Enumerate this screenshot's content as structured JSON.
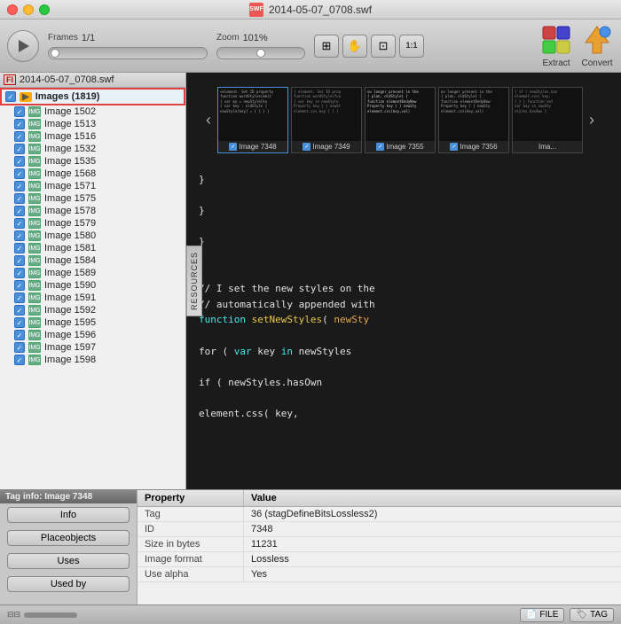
{
  "window": {
    "title": "2014-05-07_0708.swf",
    "traffic_lights": [
      "close",
      "minimize",
      "maximize"
    ]
  },
  "toolbar": {
    "play_label": "Play",
    "frames_label": "Frames",
    "frames_current": "1/1",
    "zoom_label": "Zoom",
    "zoom_value": "101%",
    "extract_label": "Extract",
    "convert_label": "Convert",
    "ratio_label": "1:1"
  },
  "sidebar": {
    "file_label": "2014-05-07_0708.swf",
    "root_label": "Images (1819)",
    "items": [
      {
        "id": "1502",
        "label": "Image 1502",
        "checked": true
      },
      {
        "id": "1513",
        "label": "Image 1513",
        "checked": true
      },
      {
        "id": "1516",
        "label": "Image 1516",
        "checked": true
      },
      {
        "id": "1532",
        "label": "Image 1532",
        "checked": true
      },
      {
        "id": "1535",
        "label": "Image 1535",
        "checked": true
      },
      {
        "id": "1568",
        "label": "Image 1568",
        "checked": true
      },
      {
        "id": "1571",
        "label": "Image 1571",
        "checked": true
      },
      {
        "id": "1575",
        "label": "Image 1575",
        "checked": true
      },
      {
        "id": "1578",
        "label": "Image 1578",
        "checked": true
      },
      {
        "id": "1579",
        "label": "Image 1579",
        "checked": true
      },
      {
        "id": "1580",
        "label": "Image 1580",
        "checked": true
      },
      {
        "id": "1581",
        "label": "Image 1581",
        "checked": true
      },
      {
        "id": "1584",
        "label": "Image 1584",
        "checked": true
      },
      {
        "id": "1589",
        "label": "Image 1589",
        "checked": true
      },
      {
        "id": "1590",
        "label": "Image 1590",
        "checked": true
      },
      {
        "id": "1591",
        "label": "Image 1591",
        "checked": true
      },
      {
        "id": "1592",
        "label": "Image 1592",
        "checked": true
      },
      {
        "id": "1595",
        "label": "Image 1595",
        "checked": true
      },
      {
        "id": "1596",
        "label": "Image 1596",
        "checked": true
      },
      {
        "id": "1597",
        "label": "Image 1597",
        "checked": true
      },
      {
        "id": "1598",
        "label": "Image 1598",
        "checked": true
      }
    ]
  },
  "thumbnails": [
    {
      "label": "Image 7348",
      "checked": true,
      "active": true
    },
    {
      "label": "Image 7349",
      "checked": true,
      "active": false
    },
    {
      "label": "Image 7355",
      "checked": true,
      "active": false
    },
    {
      "label": "Image 7356",
      "checked": true,
      "active": false
    },
    {
      "label": "Ima...",
      "checked": false,
      "active": false
    }
  ],
  "resources_tab": "RESOURCES",
  "code_lines": [
    "                    }",
    "",
    "                }",
    "",
    "            }",
    "",
    "",
    "            // I set the new styles on the",
    "            // automatically appended with",
    "            function setNewStyles( newSty",
    "",
    "                for ( var key in newStyles",
    "",
    "                    if ( newStyles.hasOwn",
    "",
    "                        element.css( key,"
  ],
  "tag_info": {
    "title": "Tag info: Image 7348",
    "btn_info": "Info",
    "btn_placeobjects": "Placeobjects",
    "btn_uses": "Uses",
    "btn_used_by": "Used by"
  },
  "properties": {
    "header_property": "Property",
    "header_value": "Value",
    "rows": [
      {
        "property": "Tag",
        "value": "36 (stagDefineBitsLossless2)"
      },
      {
        "property": "ID",
        "value": "7348"
      },
      {
        "property": "Size in bytes",
        "value": "11231"
      },
      {
        "property": "Image format",
        "value": "Lossless"
      },
      {
        "property": "Use alpha",
        "value": "Yes"
      }
    ]
  },
  "statusbar": {
    "file_label": "FILE",
    "tag_label": "TAG"
  }
}
